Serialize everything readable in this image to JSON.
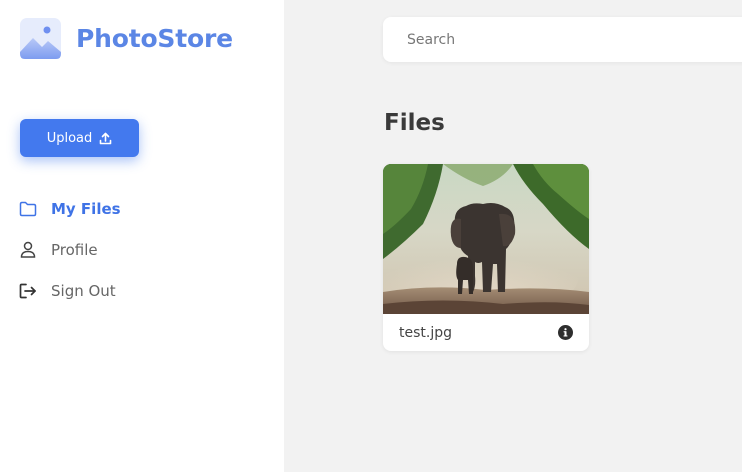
{
  "app": {
    "name": "PhotoStore"
  },
  "sidebar": {
    "upload_label": "Upload",
    "items": [
      {
        "label": "My Files",
        "icon": "folder-icon",
        "active": true
      },
      {
        "label": "Profile",
        "icon": "user-icon",
        "active": false
      },
      {
        "label": "Sign Out",
        "icon": "sign-out-icon",
        "active": false
      }
    ]
  },
  "search": {
    "placeholder": "Search",
    "value": ""
  },
  "main": {
    "title": "Files",
    "files": [
      {
        "name": "test.jpg",
        "thumbnail": "elephant-photo"
      }
    ]
  },
  "colors": {
    "accent": "#4379ee",
    "brand": "#5b86e5",
    "background": "#f2f2f2"
  }
}
